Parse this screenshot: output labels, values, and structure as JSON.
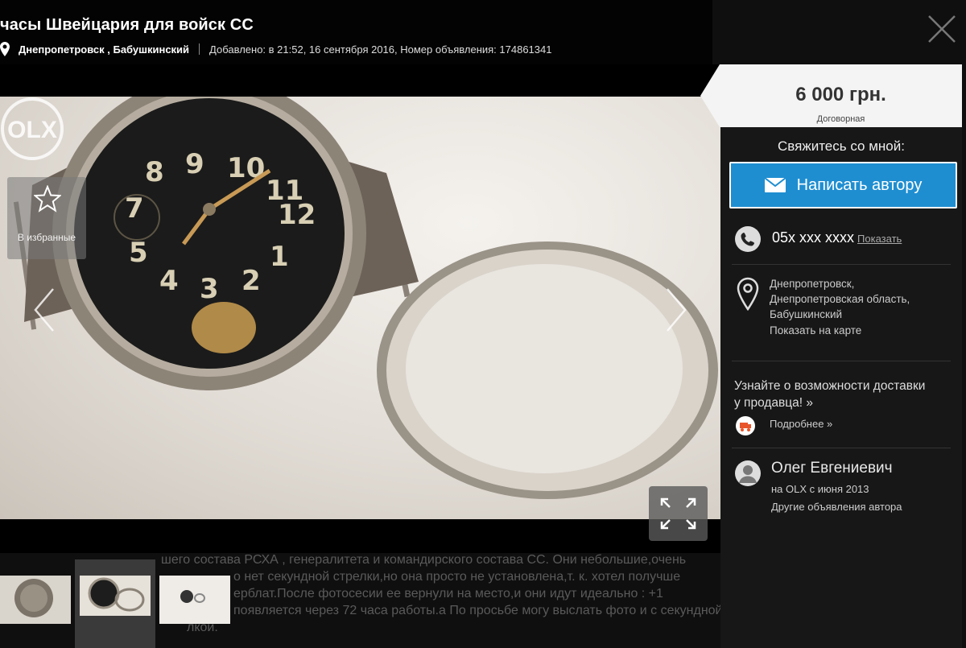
{
  "listing": {
    "title": "часы Швейцария для войск СС",
    "location": "Днепропетровск , Бабушкинский",
    "added": "Добавлено: в 21:52, 16 сентября 2016, Номер объявления: 174861341"
  },
  "description_lines": [
    "шего состава РСХА , генералитета и командирского состава СС. Они небольшие,очень",
    "о нет секундной стрелки,но она просто не установлена,т. к. хотел получше",
    "ерблат.После фотосесии ее вернули на место,и они идут идеально : +1",
    "появляется через 72 часа работы.а По просьбе могу выслать фото и с секундной",
    "лкой."
  ],
  "favorite": {
    "label": "В избранные"
  },
  "price": {
    "value": "6 000 грн.",
    "note": "Договорная"
  },
  "contact": {
    "title": "Свяжитесь со мной:",
    "write_label": "Написать автору",
    "phone": "05х ххх хххх",
    "show_label": "Показать"
  },
  "address": {
    "lines": [
      "Днепропетровск,",
      "Днепропетровская область,",
      "Бабушкинский"
    ],
    "map_link": "Показать на карте"
  },
  "delivery": {
    "line1": "Узнайте о возможности доставки",
    "line2": "у продавца! »",
    "more": "Подробнее »"
  },
  "seller": {
    "name": "Олег Евгениевич",
    "since": "на OLX с июня 2013",
    "other_ads": "Другие объявления автора"
  },
  "photo_watermark": "OLX",
  "icons": {
    "close": "close-icon",
    "pin": "map-pin-icon",
    "star": "star-icon",
    "prev": "chevron-left-icon",
    "next": "chevron-right-icon",
    "fullscreen": "fullscreen-icon",
    "mail": "mail-icon",
    "phone": "phone-icon",
    "location": "location-icon",
    "delivery": "delivery-icon",
    "user": "user-icon"
  },
  "colors": {
    "accent": "#1f8ed1",
    "price_bg": "#f4f4f4",
    "sidebar_bg": "#171717"
  }
}
